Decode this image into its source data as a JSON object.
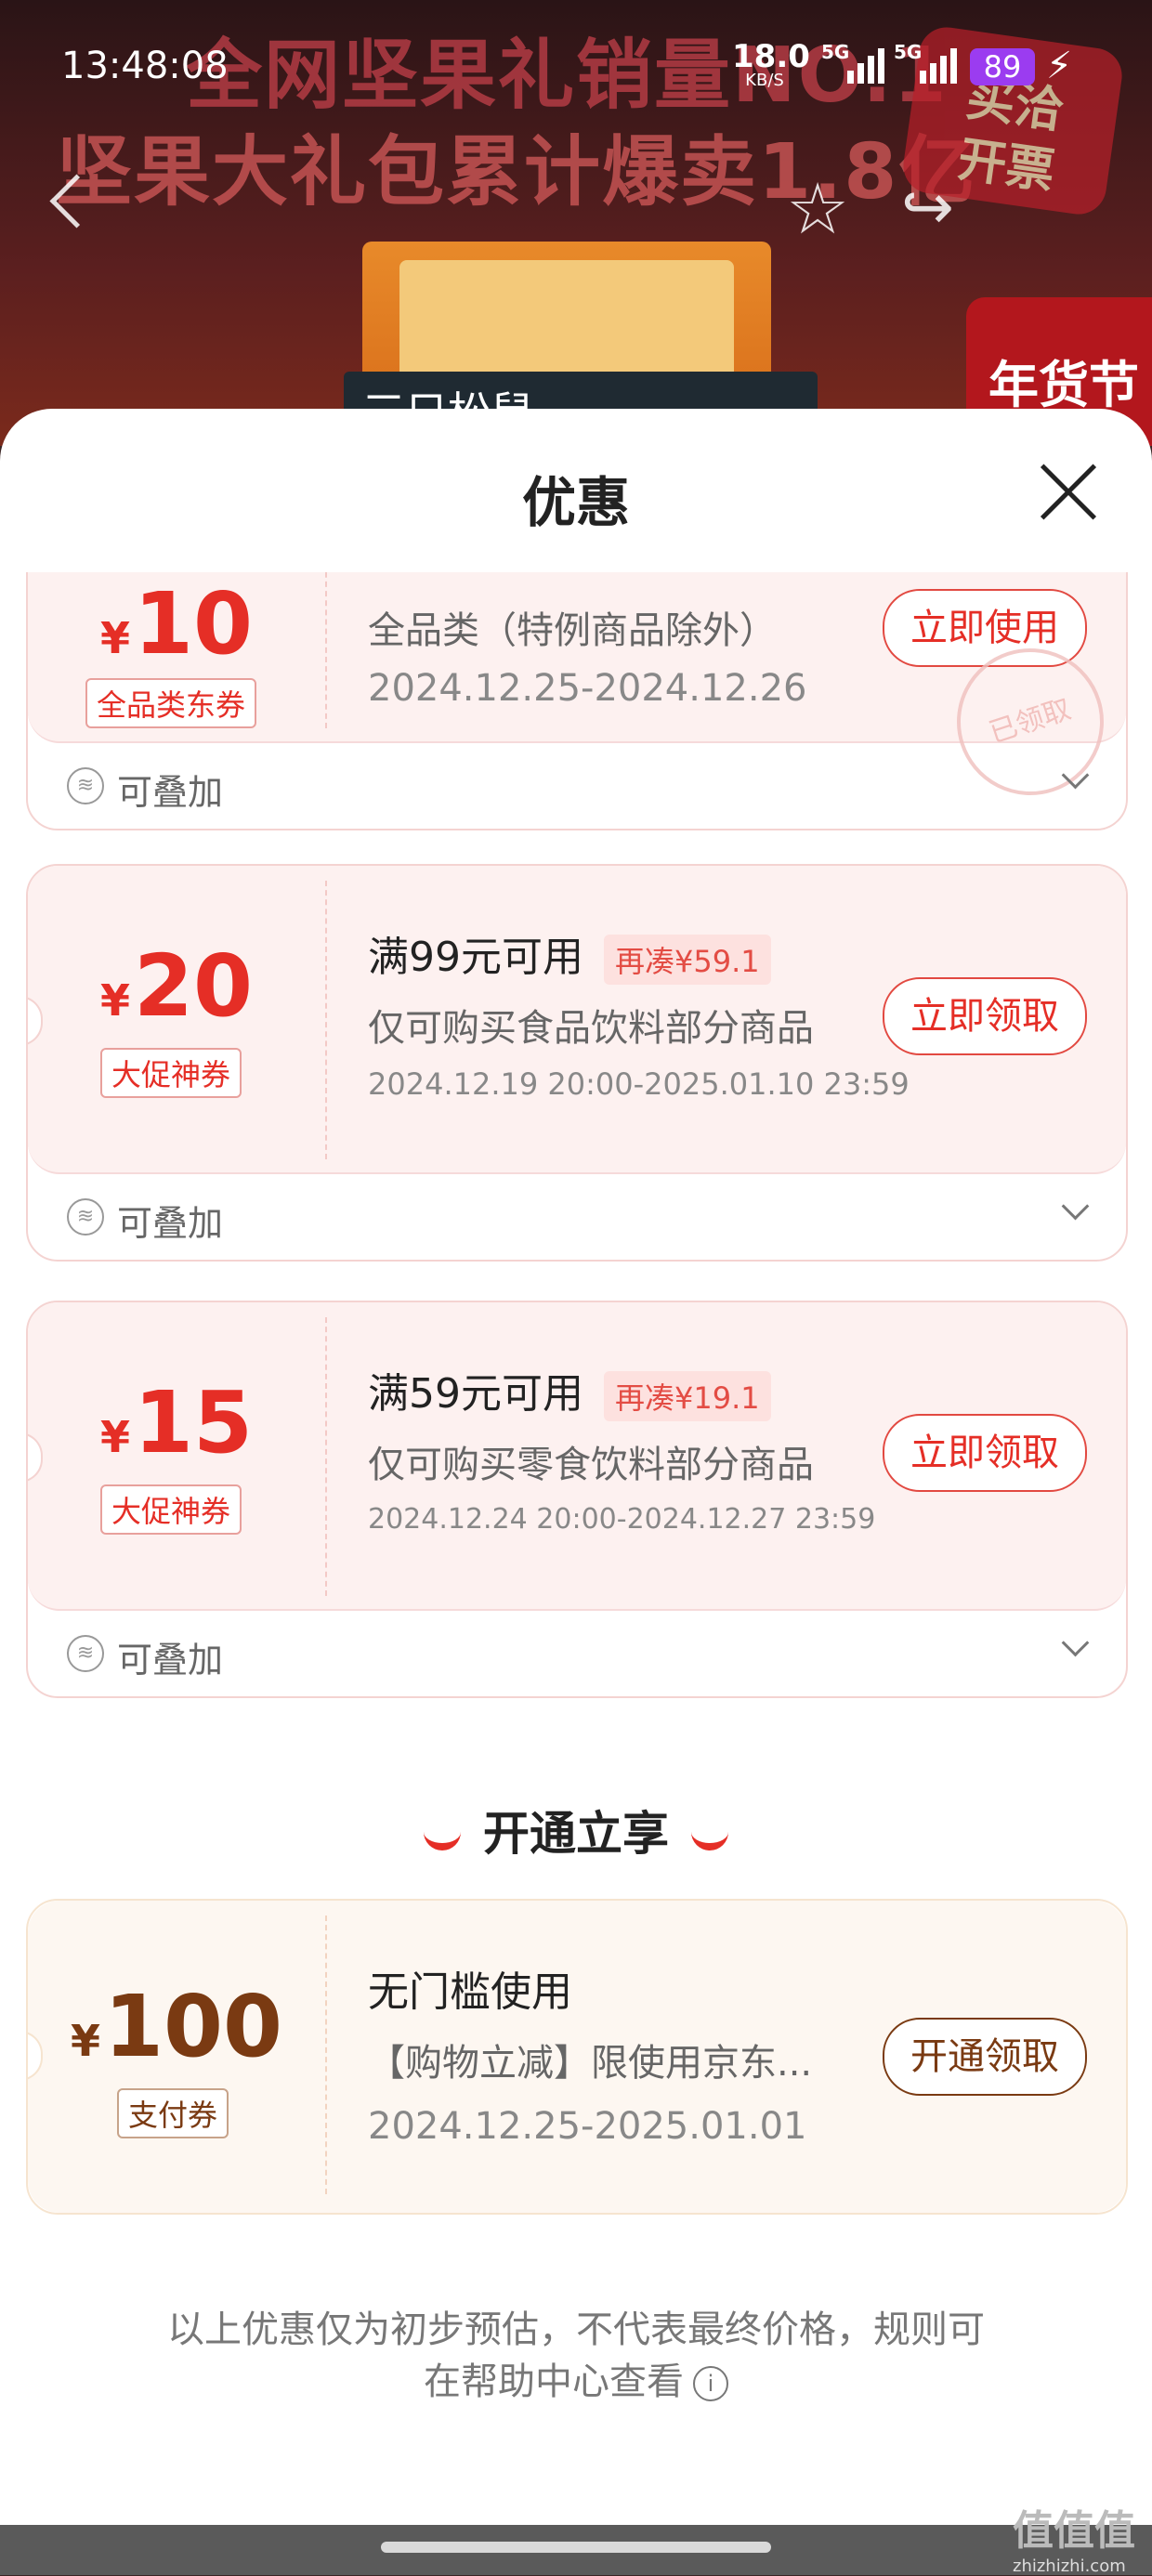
{
  "status_bar": {
    "time": "13:48:08",
    "net_speed": "18.0",
    "net_unit": "KB/S",
    "sig1": "5G",
    "sig2": "5G",
    "battery": "89"
  },
  "background": {
    "promo_line1": "全网坚果礼销量NO.1",
    "promo_line2": "坚果大礼包累计爆卖1.8亿",
    "stamp_line1": "买洽",
    "stamp_line2": "开票",
    "brand": "三只松鼠",
    "festival": "年货节"
  },
  "sheet": {
    "title": "优惠"
  },
  "coupons": [
    {
      "currency": "¥",
      "amount": "10",
      "tag": "全品类东券",
      "condition": "",
      "desc": "全品类（特例商品除外）",
      "date": "2024.12.25-2024.12.26",
      "button": "立即使用",
      "footer": "可叠加",
      "stamp": "已领取"
    },
    {
      "currency": "¥",
      "amount": "20",
      "tag": "大促神券",
      "condition": "满99元可用",
      "extra": "再凑¥59.1",
      "desc": "仅可购买食品饮料部分商品",
      "date": "2024.12.19 20:00-2025.01.10 23:59",
      "button": "立即领取",
      "footer": "可叠加"
    },
    {
      "currency": "¥",
      "amount": "15",
      "tag": "大促神券",
      "condition": "满59元可用",
      "extra": "再凑¥19.1",
      "desc": "仅可购买零食饮料部分商品",
      "date": "2024.12.24 20:00-2024.12.27 23:59",
      "button": "立即领取",
      "footer": "可叠加"
    }
  ],
  "section": {
    "title": "开通立享"
  },
  "vip_coupon": {
    "currency": "¥",
    "amount": "100",
    "tag": "支付券",
    "condition": "无门槛使用",
    "desc": "【购物立减】限使用京东...",
    "date": "2024.12.25-2025.01.01",
    "button": "开通领取"
  },
  "disclaimer": {
    "line1": "以上优惠仅为初步预估，不代表最终价格，规则可",
    "line2": "在帮助中心查看"
  },
  "watermark": {
    "big": "值值值",
    "small": "zhizhizhi.com"
  },
  "icons": {
    "back": "chevron-left-icon",
    "favorite": "star-icon",
    "share": "share-icon",
    "close": "close-icon",
    "stack": "stack-icon",
    "expand": "chevron-down-icon",
    "info": "info-icon"
  }
}
